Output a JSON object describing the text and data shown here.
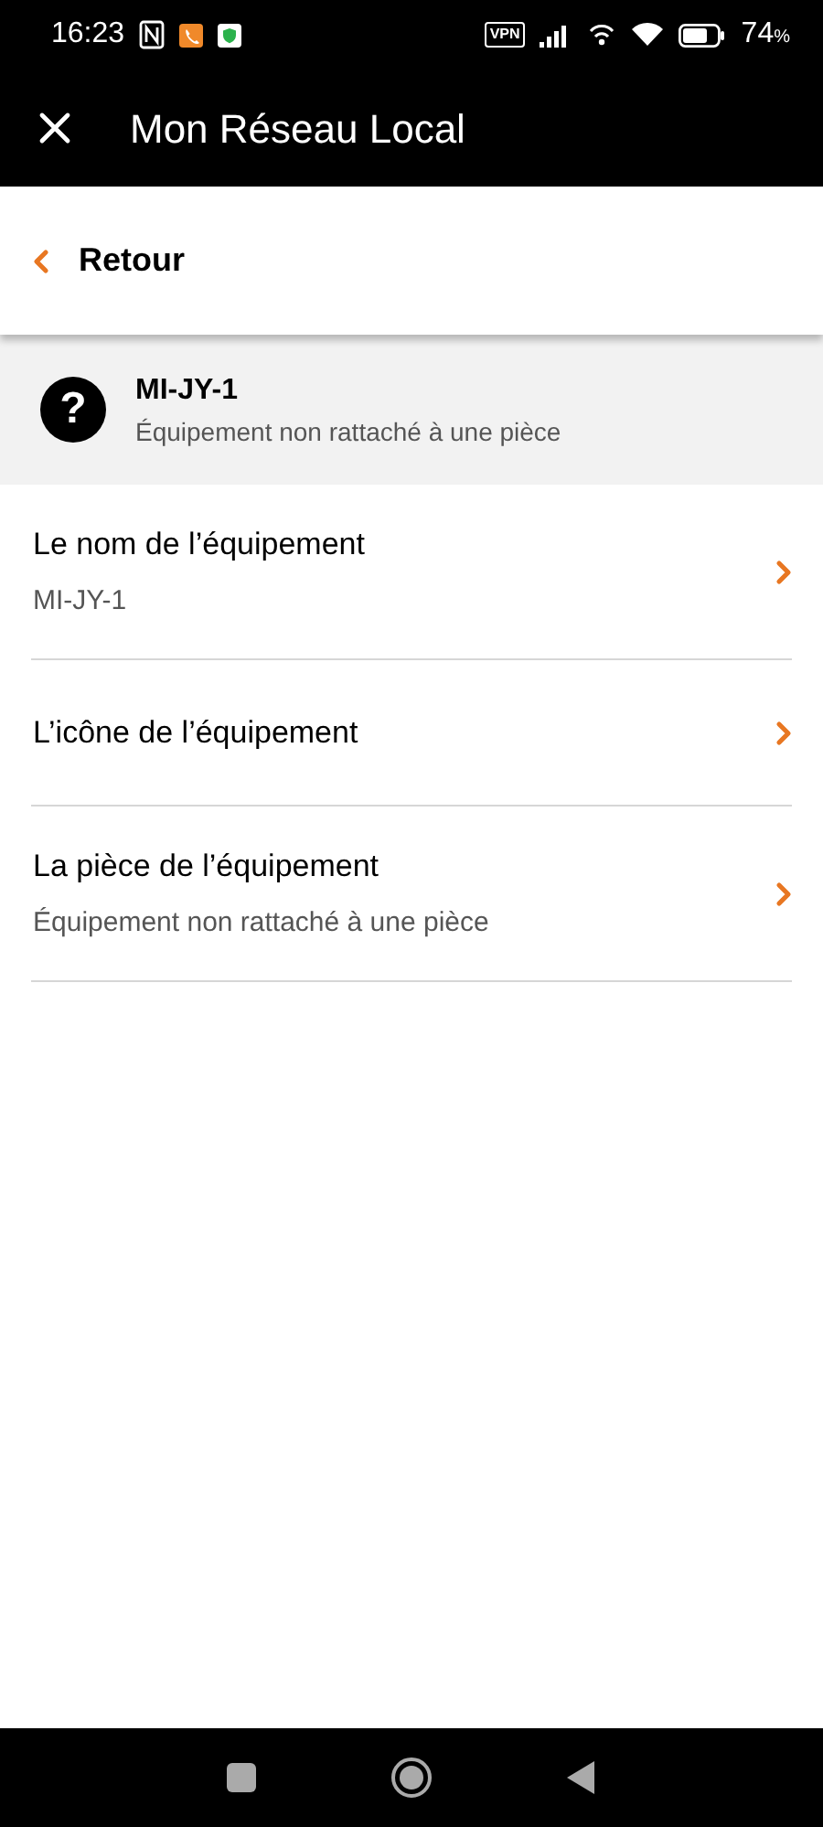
{
  "status_bar": {
    "time": "16:23",
    "vpn": "VPN",
    "battery": "74",
    "battery_unit": "%"
  },
  "app_bar": {
    "title": "Mon Réseau Local"
  },
  "back": {
    "label": "Retour"
  },
  "device": {
    "icon": "?",
    "name": "MI-JY-1",
    "room": "Équipement non rattaché à une pièce"
  },
  "settings": [
    {
      "label": "Le nom de l’équipement",
      "value": "MI-JY-1"
    },
    {
      "label": "L’icône de l’équipement"
    },
    {
      "label": "La pièce de l’équipement",
      "value": "Équipement non rattaché à une pièce"
    }
  ]
}
